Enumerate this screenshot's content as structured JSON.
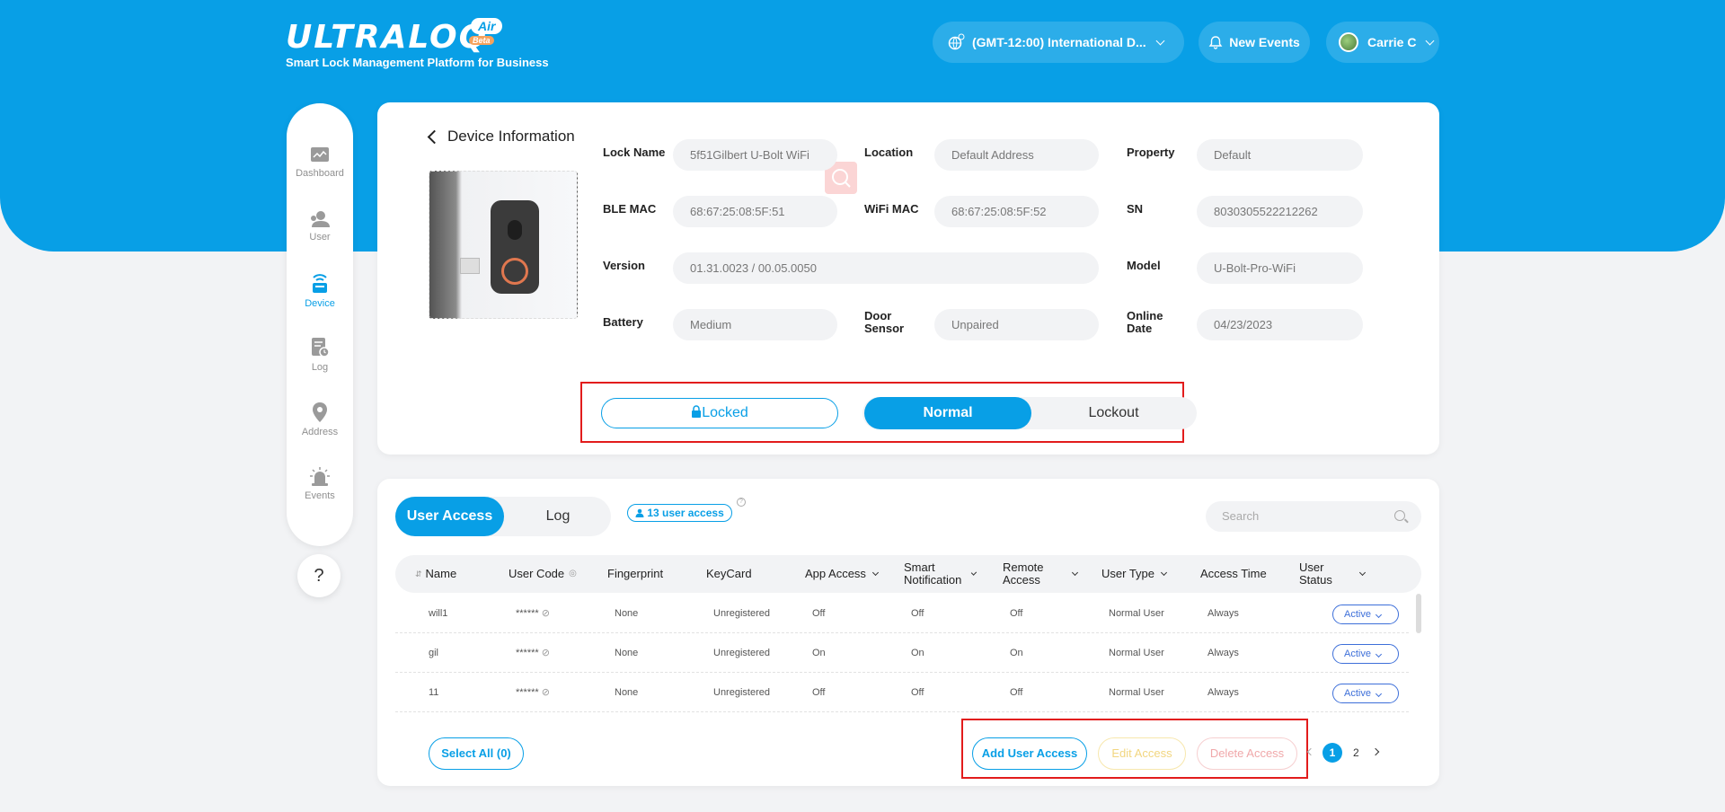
{
  "brand": {
    "logo": "ULTRALOQ",
    "air": "Air",
    "beta": "Beta",
    "subtitle": "Smart Lock Management Platform for Business"
  },
  "header": {
    "timezone": "(GMT-12:00) International D...",
    "new_events": "New Events",
    "user_name": "Carrie C"
  },
  "sidebar": {
    "items": [
      {
        "label": "Dashboard",
        "icon": "dashboard-icon"
      },
      {
        "label": "User",
        "icon": "user-icon"
      },
      {
        "label": "Device",
        "icon": "device-icon",
        "active": true
      },
      {
        "label": "Log",
        "icon": "log-icon"
      },
      {
        "label": "Address",
        "icon": "location-pin-icon"
      },
      {
        "label": "Events",
        "icon": "alarm-icon"
      }
    ],
    "help": "?"
  },
  "device": {
    "title": "Device Information",
    "fields": {
      "lock_name": {
        "label": "Lock Name",
        "value": "5f51Gilbert U-Bolt WiFi"
      },
      "location": {
        "label": "Location",
        "value": "Default Address"
      },
      "property": {
        "label": "Property",
        "value": "Default"
      },
      "ble_mac": {
        "label": "BLE MAC",
        "value": "68:67:25:08:5F:51"
      },
      "wifi_mac": {
        "label": "WiFi MAC",
        "value": "68:67:25:08:5F:52"
      },
      "sn": {
        "label": "SN",
        "value": "8030305522212262"
      },
      "version": {
        "label": "Version",
        "value": "01.31.0023 / 00.05.0050"
      },
      "model": {
        "label": "Model",
        "value": "U-Bolt-Pro-WiFi"
      },
      "battery": {
        "label": "Battery",
        "value": "Medium"
      },
      "door_sensor": {
        "label": "Door Sensor",
        "value": "Unpaired"
      },
      "online_date": {
        "label": "Online Date",
        "value": "04/23/2023"
      }
    },
    "lock_state": "Locked",
    "modes": {
      "normal": "Normal",
      "lockout": "Lockout",
      "selected": "Normal"
    }
  },
  "access": {
    "tabs": {
      "user_access": "User Access",
      "log": "Log"
    },
    "badge": "13 user access",
    "search_placeholder": "Search",
    "columns": [
      "Name",
      "User Code",
      "Fingerprint",
      "KeyCard",
      "App Access",
      "Smart Notification",
      "Remote Access",
      "User Type",
      "Access Time",
      "User Status"
    ],
    "rows": [
      {
        "name": "will1",
        "code": "******",
        "fingerprint": "None",
        "keycard": "Unregistered",
        "app": "Off",
        "smart": "Off",
        "remote": "Off",
        "type": "Normal User",
        "time": "Always",
        "status": "Active"
      },
      {
        "name": "gil",
        "code": "******",
        "fingerprint": "None",
        "keycard": "Unregistered",
        "app": "On",
        "smart": "On",
        "remote": "On",
        "type": "Normal User",
        "time": "Always",
        "status": "Active"
      },
      {
        "name": "11",
        "code": "******",
        "fingerprint": "None",
        "keycard": "Unregistered",
        "app": "Off",
        "smart": "Off",
        "remote": "Off",
        "type": "Normal User",
        "time": "Always",
        "status": "Active"
      }
    ],
    "select_all": "Select All (0)",
    "actions": {
      "add": "Add User Access",
      "edit": "Edit Access",
      "delete": "Delete Access"
    },
    "pages": [
      "1",
      "2"
    ],
    "current_page": "1"
  },
  "colors": {
    "primary": "#089fe6",
    "highlight": "#e21c1c",
    "edit_disabled": "#f2d680",
    "delete_disabled": "#f0a8aa"
  }
}
